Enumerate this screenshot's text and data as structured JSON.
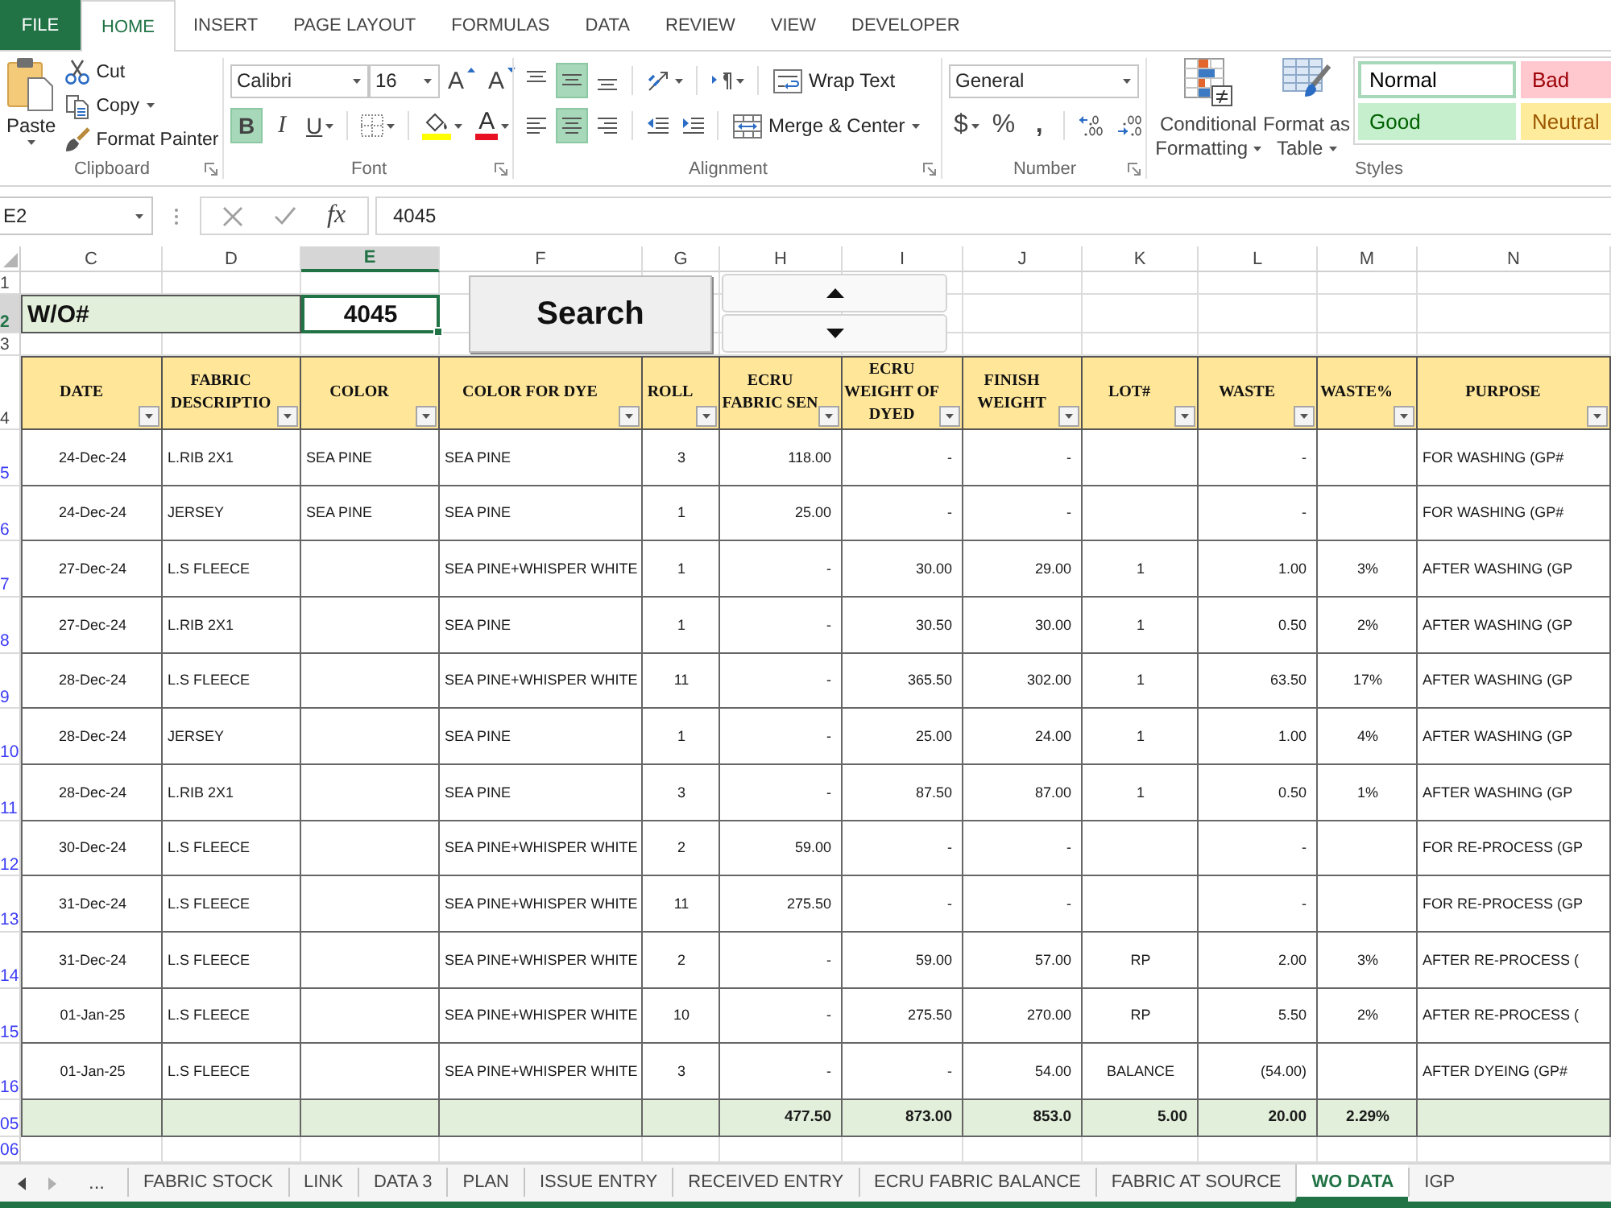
{
  "ribbon_tabs": [
    {
      "label": "FILE",
      "kind": "file",
      "selected": false
    },
    {
      "label": "HOME",
      "kind": "tab",
      "selected": true
    },
    {
      "label": "INSERT",
      "kind": "tab",
      "selected": false
    },
    {
      "label": "PAGE LAYOUT",
      "kind": "tab",
      "selected": false
    },
    {
      "label": "FORMULAS",
      "kind": "tab",
      "selected": false
    },
    {
      "label": "DATA",
      "kind": "tab",
      "selected": false
    },
    {
      "label": "REVIEW",
      "kind": "tab",
      "selected": false
    },
    {
      "label": "VIEW",
      "kind": "tab",
      "selected": false
    },
    {
      "label": "DEVELOPER",
      "kind": "tab",
      "selected": false
    }
  ],
  "ribbon": {
    "clipboard": {
      "title": "Clipboard",
      "paste": "Paste",
      "cut": "Cut",
      "copy": "Copy",
      "format_painter": "Format Painter"
    },
    "font": {
      "title": "Font",
      "font_name": "Calibri",
      "font_size": "16",
      "grow": "A",
      "shrink": "A",
      "toggles": [
        {
          "label": "B",
          "kind": "bold",
          "selected": true
        },
        {
          "label": "I",
          "kind": "italic",
          "selected": false
        },
        {
          "label": "U",
          "kind": "underline",
          "selected": false
        }
      ],
      "font_color": "A"
    },
    "alignment": {
      "title": "Alignment",
      "vertical": [
        {
          "kind": "top",
          "selected": false
        },
        {
          "kind": "middle",
          "selected": true
        },
        {
          "kind": "bottom",
          "selected": false
        }
      ],
      "horizontal": [
        {
          "kind": "left",
          "selected": false
        },
        {
          "kind": "center",
          "selected": true
        },
        {
          "kind": "right",
          "selected": false
        }
      ],
      "wrap_text": "Wrap Text",
      "merge_center": "Merge & Center"
    },
    "number": {
      "title": "Number",
      "format": "General",
      "currency": "$",
      "percent": "%",
      "comma": ","
    },
    "styles": {
      "title": "Styles",
      "conditional_formatting": "Conditional Formatting",
      "format_as_table": "Format as Table",
      "gallery": [
        {
          "label": "Normal",
          "kind": "normal",
          "selected": true
        },
        {
          "label": "Bad",
          "kind": "bad",
          "selected": false
        },
        {
          "label": "Good",
          "kind": "good",
          "selected": false
        },
        {
          "label": "Neutral",
          "kind": "neutral",
          "selected": false
        }
      ]
    }
  },
  "formula_bar": {
    "name_box": "E2",
    "function_button": "fx",
    "formula": "4045"
  },
  "sheet": {
    "column_headers": [
      {
        "letter": "C",
        "selected": false
      },
      {
        "letter": "D",
        "selected": false
      },
      {
        "letter": "E",
        "selected": true
      },
      {
        "letter": "F",
        "selected": false
      },
      {
        "letter": "G",
        "selected": false
      },
      {
        "letter": "H",
        "selected": false
      },
      {
        "letter": "I",
        "selected": false
      },
      {
        "letter": "J",
        "selected": false
      },
      {
        "letter": "K",
        "selected": false
      },
      {
        "letter": "L",
        "selected": false
      },
      {
        "letter": "M",
        "selected": false
      },
      {
        "letter": "N",
        "selected": false
      }
    ],
    "row_headers": [
      {
        "number": "1",
        "selected": false,
        "filtered": false
      },
      {
        "number": "2",
        "selected": true,
        "filtered": false
      },
      {
        "number": "3",
        "selected": false,
        "filtered": false
      },
      {
        "number": "4",
        "selected": false,
        "filtered": false
      },
      {
        "number": "5",
        "selected": false,
        "filtered": true
      },
      {
        "number": "6",
        "selected": false,
        "filtered": true
      },
      {
        "number": "7",
        "selected": false,
        "filtered": true
      },
      {
        "number": "8",
        "selected": false,
        "filtered": true
      },
      {
        "number": "9",
        "selected": false,
        "filtered": true
      },
      {
        "number": "10",
        "selected": false,
        "filtered": true
      },
      {
        "number": "11",
        "selected": false,
        "filtered": true
      },
      {
        "number": "12",
        "selected": false,
        "filtered": true
      },
      {
        "number": "13",
        "selected": false,
        "filtered": true
      },
      {
        "number": "14",
        "selected": false,
        "filtered": true
      },
      {
        "number": "15",
        "selected": false,
        "filtered": true
      },
      {
        "number": "16",
        "selected": false,
        "filtered": true
      },
      {
        "number": "05",
        "selected": false,
        "filtered": true
      },
      {
        "number": "06",
        "selected": false,
        "filtered": true
      }
    ],
    "wo_label": "W/O#",
    "wo_number": "4045",
    "search_button": "Search",
    "table": {
      "headers": [
        "DATE",
        "FABRIC DESCRIPTIO",
        "COLOR",
        "COLOR FOR DYE",
        "ROLL",
        "ECRU FABRIC SEN",
        "ECRU WEIGHT OF DYED",
        "FINISH WEIGHT",
        "LOT#",
        "WASTE",
        "WASTE%",
        "PURPOSE"
      ],
      "rows": [
        {
          "date": "24-Dec-24",
          "fabric": "L.RIB 2X1",
          "shade": "SEA PINE",
          "dye_shade": "SEA PINE",
          "roll": "3",
          "ecru_sent": "118.00",
          "ecru_dyed": "-",
          "finish": "-",
          "waste": "-",
          "purpose": "FOR WASHING (GP#"
        },
        {
          "date": "24-Dec-24",
          "fabric": "JERSEY",
          "shade": "SEA PINE",
          "dye_shade": "SEA PINE",
          "roll": "1",
          "ecru_sent": "25.00",
          "ecru_dyed": "-",
          "finish": "-",
          "waste": "-",
          "purpose": "FOR WASHING (GP#"
        },
        {
          "date": "27-Dec-24",
          "fabric": "L.S FLEECE",
          "dye_shade": "SEA PINE+WHISPER WHITE",
          "roll": "1",
          "ecru_sent": "-",
          "ecru_dyed": "30.00",
          "finish": "29.00",
          "lot": "1",
          "waste": "1.00",
          "waste_pct": "3%",
          "purpose": "AFTER WASHING (GP"
        },
        {
          "date": "27-Dec-24",
          "fabric": "L.RIB 2X1",
          "dye_shade": "SEA PINE",
          "roll": "1",
          "ecru_sent": "-",
          "ecru_dyed": "30.50",
          "finish": "30.00",
          "lot": "1",
          "waste": "0.50",
          "waste_pct": "2%",
          "purpose": "AFTER WASHING (GP"
        },
        {
          "date": "28-Dec-24",
          "fabric": "L.S FLEECE",
          "dye_shade": "SEA PINE+WHISPER WHITE",
          "roll": "11",
          "ecru_sent": "-",
          "ecru_dyed": "365.50",
          "finish": "302.00",
          "lot": "1",
          "waste": "63.50",
          "waste_pct": "17%",
          "purpose": "AFTER WASHING (GP"
        },
        {
          "date": "28-Dec-24",
          "fabric": "JERSEY",
          "dye_shade": "SEA PINE",
          "roll": "1",
          "ecru_sent": "-",
          "ecru_dyed": "25.00",
          "finish": "24.00",
          "lot": "1",
          "waste": "1.00",
          "waste_pct": "4%",
          "purpose": "AFTER WASHING (GP"
        },
        {
          "date": "28-Dec-24",
          "fabric": "L.RIB 2X1",
          "dye_shade": "SEA PINE",
          "roll": "3",
          "ecru_sent": "-",
          "ecru_dyed": "87.50",
          "finish": "87.00",
          "lot": "1",
          "waste": "0.50",
          "waste_pct": "1%",
          "purpose": "AFTER WASHING (GP"
        },
        {
          "date": "30-Dec-24",
          "fabric": "L.S FLEECE",
          "dye_shade": "SEA PINE+WHISPER WHITE",
          "roll": "2",
          "ecru_sent": "59.00",
          "ecru_dyed": "-",
          "finish": "-",
          "waste": "-",
          "purpose": "FOR RE-PROCESS (GP"
        },
        {
          "date": "31-Dec-24",
          "fabric": "L.S FLEECE",
          "dye_shade": "SEA PINE+WHISPER WHITE",
          "roll": "11",
          "ecru_sent": "275.50",
          "ecru_dyed": "-",
          "finish": "-",
          "waste": "-",
          "purpose": "FOR RE-PROCESS (GP"
        },
        {
          "date": "31-Dec-24",
          "fabric": "L.S FLEECE",
          "dye_shade": "SEA PINE+WHISPER WHITE",
          "roll": "2",
          "ecru_sent": "-",
          "ecru_dyed": "59.00",
          "finish": "57.00",
          "lot": "RP",
          "waste": "2.00",
          "waste_pct": "3%",
          "purpose": "AFTER RE-PROCESS ("
        },
        {
          "date": "01-Jan-25",
          "fabric": "L.S FLEECE",
          "dye_shade": "SEA PINE+WHISPER WHITE",
          "roll": "10",
          "ecru_sent": "-",
          "ecru_dyed": "275.50",
          "finish": "270.00",
          "lot": "RP",
          "waste": "5.50",
          "waste_pct": "2%",
          "purpose": "AFTER RE-PROCESS ("
        },
        {
          "date": "01-Jan-25",
          "fabric": "L.S FLEECE",
          "dye_shade": "SEA PINE+WHISPER WHITE",
          "roll": "3",
          "ecru_sent": "-",
          "ecru_dyed": "-",
          "finish": "54.00",
          "lot": "BALANCE",
          "waste": "(54.00)",
          "purpose": "AFTER DYEING (GP#"
        }
      ],
      "totals": {
        "ecru_sent": "477.50",
        "ecru_dyed": "873.00",
        "finish": "853.0",
        "lot": "5.00",
        "waste": "20.00",
        "waste_pct": "2.29%"
      }
    }
  },
  "sheet_tabs": {
    "more": "...",
    "tabs": [
      {
        "label": "FABRIC STOCK",
        "selected": false
      },
      {
        "label": "LINK",
        "selected": false
      },
      {
        "label": "DATA 3",
        "selected": false
      },
      {
        "label": "PLAN",
        "selected": false
      },
      {
        "label": "ISSUE ENTRY",
        "selected": false
      },
      {
        "label": "RECEIVED ENTRY",
        "selected": false
      },
      {
        "label": "ECRU FABRIC BALANCE",
        "selected": false
      },
      {
        "label": "FABRIC AT SOURCE",
        "selected": false
      },
      {
        "label": "WO DATA",
        "selected": true
      },
      {
        "label": "IGP",
        "selected": false
      }
    ]
  }
}
